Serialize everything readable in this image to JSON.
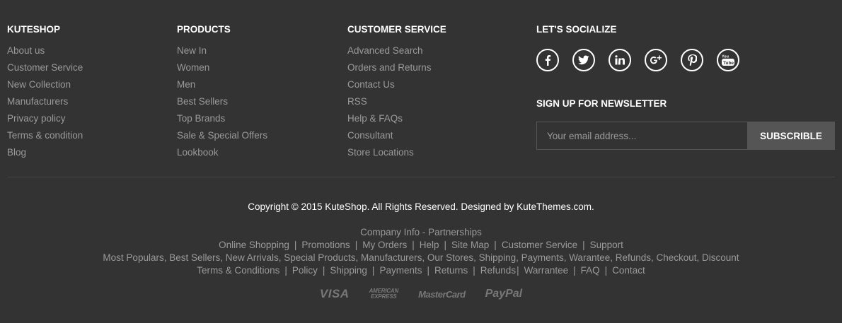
{
  "columns": [
    {
      "title": "KUTESHOP",
      "links": [
        "About us",
        "Customer Service",
        "New Collection",
        "Manufacturers",
        "Privacy policy",
        "Terms & condition",
        "Blog"
      ]
    },
    {
      "title": "PRODUCTS",
      "links": [
        "New In",
        "Women",
        "Men",
        "Best Sellers",
        "Top Brands",
        "Sale & Special Offers",
        "Lookbook"
      ]
    },
    {
      "title": "CUSTOMER SERVICE",
      "links": [
        "Advanced Search",
        "Orders and Returns",
        "Contact Us",
        "RSS",
        "Help & FAQs",
        "Consultant",
        "Store Locations"
      ]
    }
  ],
  "social": {
    "title": "LET'S SOCIALIZE",
    "icons": [
      "facebook-icon",
      "twitter-icon",
      "linkedin-icon",
      "google-plus-icon",
      "pinterest-icon",
      "youtube-icon"
    ]
  },
  "newsletter": {
    "title": "SIGN UP FOR NEWSLETTER",
    "placeholder": "Your email address...",
    "button": "SUBSCRIBLE"
  },
  "copyright": "Copyright © 2015 KuteShop. All Rights Reserved. Designed by KuteThemes.com.",
  "bottom_links": {
    "row1": "Company Info - Partnerships",
    "row2": [
      "Online Shopping",
      "Promotions",
      "My Orders",
      "Help",
      "Site Map",
      "Customer Service",
      "Support"
    ],
    "row3": "Most Populars, Best Sellers, New Arrivals, Special Products, Manufacturers, Our Stores, Shipping, Payments, Warantee, Refunds, Checkout, Discount",
    "row4": [
      "Terms & Conditions",
      "Policy",
      "Shipping",
      "Payments",
      "Returns",
      "Refunds",
      "Warrantee",
      "FAQ",
      "Contact"
    ]
  },
  "payments": {
    "visa": "VISA",
    "amex_line1": "AMERICAN",
    "amex_line2": "EXPRESS",
    "mastercard": "MasterCard",
    "paypal": "PayPal"
  },
  "colors": {
    "background": "#333333",
    "heading": "#ffffff",
    "link": "#9a9a9a",
    "button_bg": "#555555"
  }
}
